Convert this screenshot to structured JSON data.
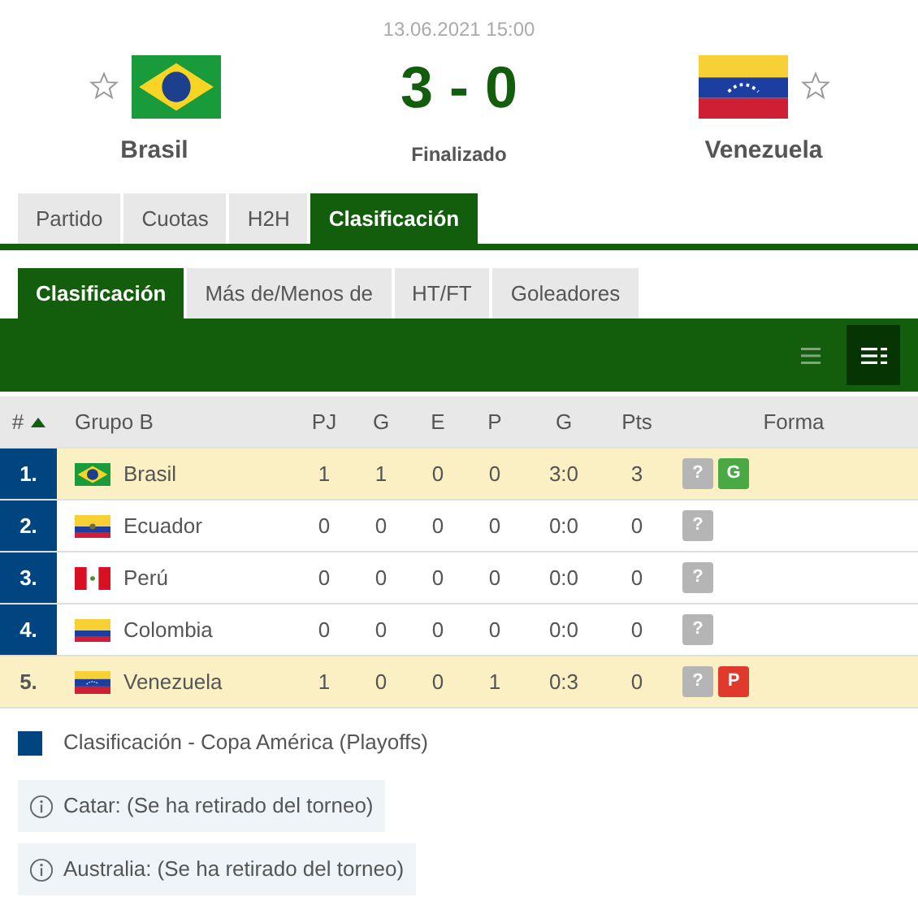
{
  "match": {
    "date": "13.06.2021 15:00",
    "score": "3 - 0",
    "status": "Finalizado",
    "home": {
      "name": "Brasil",
      "flag": {
        "kind": "brazil"
      },
      "favorite": false
    },
    "away": {
      "name": "Venezuela",
      "flag": {
        "kind": "venezuela"
      },
      "favorite": false
    }
  },
  "tabs": [
    {
      "label": "Partido",
      "selected": false
    },
    {
      "label": "Cuotas",
      "selected": false
    },
    {
      "label": "H2H",
      "selected": false
    },
    {
      "label": "Clasificación",
      "selected": true
    }
  ],
  "subtabs": [
    {
      "label": "Clasificación",
      "selected": true
    },
    {
      "label": "Más de/Menos de",
      "selected": false
    },
    {
      "label": "HT/FT",
      "selected": false
    },
    {
      "label": "Goleadores",
      "selected": false
    }
  ],
  "view_toggles": [
    {
      "kind": "compact",
      "selected": false
    },
    {
      "kind": "full",
      "selected": true
    }
  ],
  "table": {
    "columns": [
      {
        "label": "#",
        "sorted": true
      },
      {
        "label": "Grupo B",
        "sorted": false
      },
      {
        "label": "PJ",
        "sorted": false
      },
      {
        "label": "G",
        "sorted": false
      },
      {
        "label": "E",
        "sorted": false
      },
      {
        "label": "P",
        "sorted": false
      },
      {
        "label": "G",
        "sorted": false
      },
      {
        "label": "Pts",
        "sorted": false
      },
      {
        "label": "Forma",
        "sorted": false
      }
    ],
    "rows": [
      {
        "rank": "1.",
        "qualified": true,
        "highlighted": true,
        "flag": {
          "kind": "brazil"
        },
        "team": "Brasil",
        "pj": "1",
        "g": "1",
        "e": "0",
        "p": "0",
        "goals": "3:0",
        "pts": "3",
        "form": [
          {
            "label": "?",
            "kind": "upcoming"
          },
          {
            "label": "G",
            "kind": "win"
          }
        ]
      },
      {
        "rank": "2.",
        "qualified": true,
        "highlighted": false,
        "flag": {
          "kind": "ecuador"
        },
        "team": "Ecuador",
        "pj": "0",
        "g": "0",
        "e": "0",
        "p": "0",
        "goals": "0:0",
        "pts": "0",
        "form": [
          {
            "label": "?",
            "kind": "upcoming"
          }
        ]
      },
      {
        "rank": "3.",
        "qualified": true,
        "highlighted": false,
        "flag": {
          "kind": "peru"
        },
        "team": "Perú",
        "pj": "0",
        "g": "0",
        "e": "0",
        "p": "0",
        "goals": "0:0",
        "pts": "0",
        "form": [
          {
            "label": "?",
            "kind": "upcoming"
          }
        ]
      },
      {
        "rank": "4.",
        "qualified": true,
        "highlighted": false,
        "flag": {
          "kind": "colombia"
        },
        "team": "Colombia",
        "pj": "0",
        "g": "0",
        "e": "0",
        "p": "0",
        "goals": "0:0",
        "pts": "0",
        "form": [
          {
            "label": "?",
            "kind": "upcoming"
          }
        ]
      },
      {
        "rank": "5.",
        "qualified": false,
        "highlighted": true,
        "flag": {
          "kind": "venezuela"
        },
        "team": "Venezuela",
        "pj": "1",
        "g": "0",
        "e": "0",
        "p": "1",
        "goals": "0:3",
        "pts": "0",
        "form": [
          {
            "label": "?",
            "kind": "upcoming"
          },
          {
            "label": "P",
            "kind": "loss"
          }
        ]
      }
    ]
  },
  "legend": {
    "color": "#00457f",
    "label": "Clasificación - Copa América (Playoffs)"
  },
  "notes": [
    "Catar: (Se ha retirado del torneo)",
    "Australia: (Se ha retirado del torneo)"
  ]
}
